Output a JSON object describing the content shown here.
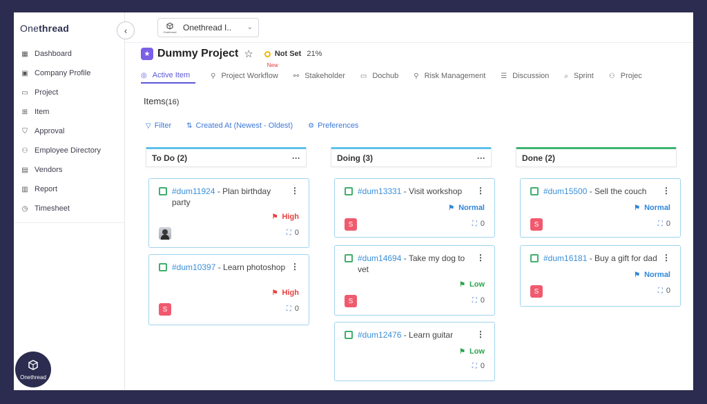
{
  "brand": {
    "logo_pre": "One",
    "logo_bold": "thread",
    "badge_label": "Onethread"
  },
  "sidebar": {
    "items": [
      {
        "label": "Dashboard",
        "icon": "dashboard-icon"
      },
      {
        "label": "Company Profile",
        "icon": "briefcase-icon"
      },
      {
        "label": "Project",
        "icon": "folder-icon"
      },
      {
        "label": "Item",
        "icon": "item-icon"
      },
      {
        "label": "Approval",
        "icon": "shield-check-icon"
      },
      {
        "label": "Employee Directory",
        "icon": "people-icon"
      },
      {
        "label": "Vendors",
        "icon": "vendor-icon"
      },
      {
        "label": "Report",
        "icon": "bar-chart-icon"
      },
      {
        "label": "Timesheet",
        "icon": "clock-icon"
      }
    ]
  },
  "workspace": {
    "name": "Onethread I..",
    "logo_caption": "Onethread"
  },
  "project": {
    "title": "Dummy Project",
    "status": "Not Set",
    "progress": "21%",
    "status_color": "#f0b400",
    "icon_color": "#7b5fe6"
  },
  "tabs": [
    {
      "label": "Active Item",
      "active": true
    },
    {
      "label": "Project Workflow",
      "badge": "New"
    },
    {
      "label": "Stakeholder"
    },
    {
      "label": "Dochub"
    },
    {
      "label": "Risk Management"
    },
    {
      "label": "Discussion"
    },
    {
      "label": "Sprint"
    },
    {
      "label": "Projec"
    }
  ],
  "items_header": {
    "label": "Items",
    "count": "(16)"
  },
  "toolbar": {
    "filter": "Filter",
    "sort": "Created At (Newest - Oldest)",
    "preferences": "Preferences"
  },
  "columns": [
    {
      "title": "To Do",
      "count": "(2)",
      "accent": "#5ec0ea",
      "cards": [
        {
          "id": "#dum11924",
          "title": " - Plan birthday party",
          "priority": "High",
          "assignee": "",
          "subtasks": "0"
        },
        {
          "id": "#dum10397",
          "title": " - Learn photoshop",
          "priority": "High",
          "assignee": "S",
          "subtasks": "0"
        }
      ]
    },
    {
      "title": "Doing",
      "count": "(3)",
      "accent": "#5ec0ea",
      "cards": [
        {
          "id": "#dum13331",
          "title": " - Visit workshop",
          "priority": "Normal",
          "assignee": "S",
          "subtasks": "0"
        },
        {
          "id": "#dum14694",
          "title": " - Take my dog to vet",
          "priority": "Low",
          "assignee": "S",
          "subtasks": "0"
        },
        {
          "id": "#dum12476",
          "title": " - Learn guitar",
          "priority": "Low",
          "assignee": "",
          "subtasks": "0"
        }
      ]
    },
    {
      "title": "Done",
      "count": "(2)",
      "accent": "#3cb371",
      "cards": [
        {
          "id": "#dum15500",
          "title": " - Sell the couch",
          "priority": "Normal",
          "assignee": "S",
          "subtasks": "0"
        },
        {
          "id": "#dum16181",
          "title": " - Buy a gift for dad",
          "priority": "Normal",
          "assignee": "S",
          "subtasks": "0"
        }
      ]
    }
  ]
}
